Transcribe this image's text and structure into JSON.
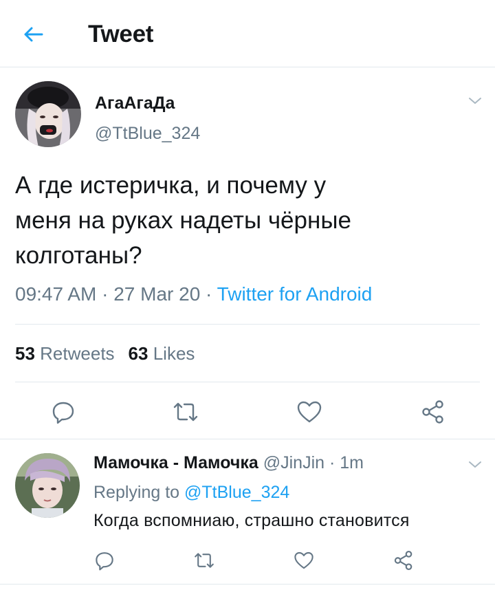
{
  "header": {
    "title": "Tweet",
    "back_icon": "arrow-left-icon"
  },
  "colors": {
    "accent": "#1da1f2",
    "muted": "#657786",
    "text": "#14171a",
    "divider": "#e1e8ed"
  },
  "tweet": {
    "author_name": "АгаАгаДа",
    "author_handle": "@TtBlue_324",
    "lines": [
      "А где истеричка, и почему у",
      "меня на руках надеты чёрные",
      "колготаны?"
    ],
    "time": "09:47 AM",
    "sep1": " · ",
    "date": "27 Mar 20",
    "sep2": " · ",
    "source": "Twitter for Android",
    "retweets_count": "53",
    "retweets_label": "Retweets",
    "likes_count": "63",
    "likes_label": "Likes"
  },
  "actions": [
    "reply-icon",
    "retweet-icon",
    "like-icon",
    "share-icon"
  ],
  "reply": {
    "author_name": "Мамочка - Мамочка",
    "author_handle": "@JinJin",
    "sep": " · ",
    "time": "1m",
    "replying_prefix": "Replying to",
    "replying_to": "@TtBlue_324",
    "text": "Когда вспомниаю, страшно становится"
  }
}
